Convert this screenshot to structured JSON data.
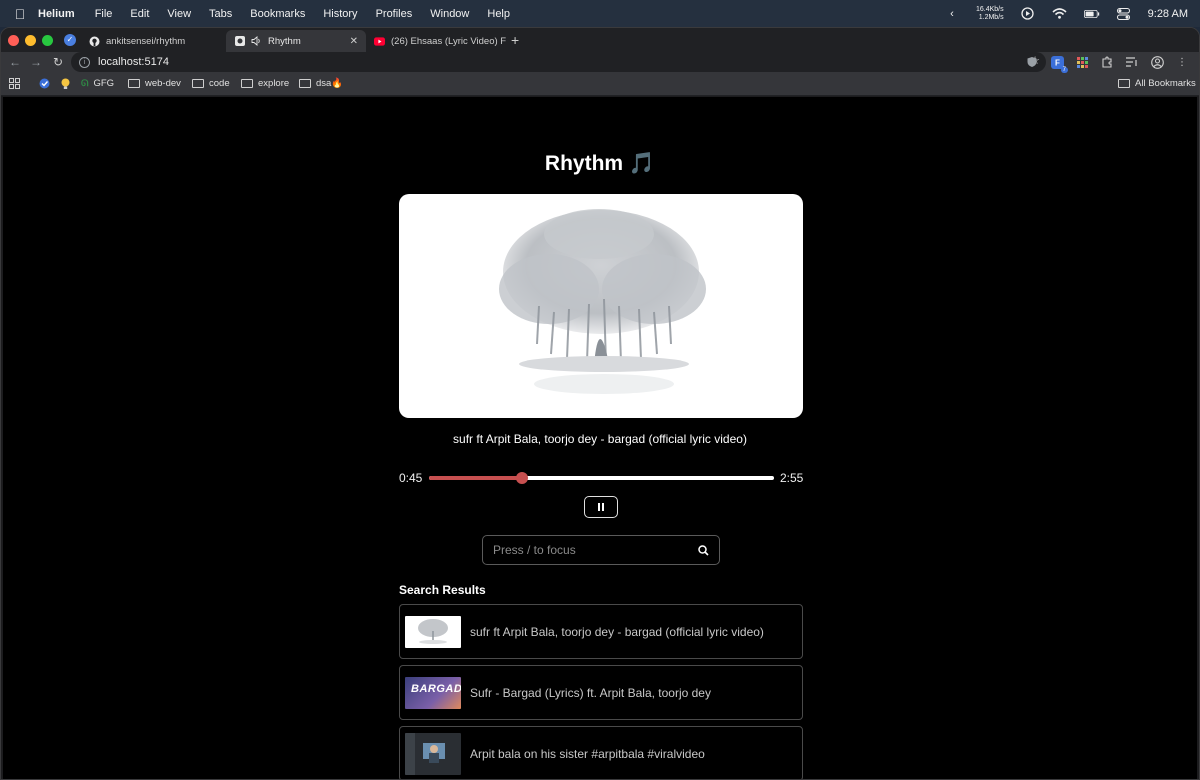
{
  "menubar": {
    "app_name": "Helium",
    "items": [
      "File",
      "Edit",
      "View",
      "Tabs",
      "Bookmarks",
      "History",
      "Profiles",
      "Window",
      "Help"
    ],
    "net_up": "16.4Kb/s",
    "net_down": "1.2Mb/s",
    "clock": "9:28 AM"
  },
  "browser": {
    "tabs": [
      {
        "title": "ankitsensei/rhythm",
        "icon": "github-icon"
      },
      {
        "title": "Rhythm",
        "icon": "speaker-icon",
        "active": true
      },
      {
        "title": "(26) Ehsaas (Lyric Video) Fa",
        "icon": "youtube-icon"
      }
    ],
    "url": "localhost:5174",
    "bookmarks": [
      "GFG",
      "web-dev",
      "code",
      "explore",
      "dsa🔥"
    ],
    "all_bookmarks": "All Bookmarks",
    "extension_badge": "7"
  },
  "app": {
    "title": "Rhythm 🎵",
    "now_playing": "sufr ft Arpit Bala, toorjo dey - bargad (official lyric video)",
    "current_time": "0:45",
    "duration": "2:55",
    "progress": 0.27,
    "search_placeholder": "Press / to focus",
    "results_heading": "Search Results",
    "results": [
      {
        "title": "sufr ft Arpit Bala, toorjo dey - bargad (official lyric video)"
      },
      {
        "title": "Sufr - Bargad (Lyrics) ft. Arpit Bala, toorjo dey",
        "thumb_text": "BARGAD"
      },
      {
        "title": "Arpit bala on his sister #arpitbala #viralvideo"
      }
    ]
  },
  "colors": {
    "progress": "#c75050",
    "page_bg": "#000000"
  }
}
